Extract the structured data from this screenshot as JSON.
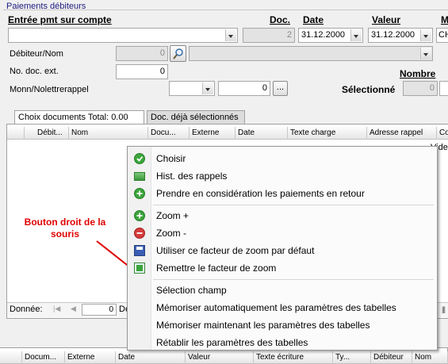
{
  "group": {
    "title": "Paiements débiteurs"
  },
  "header": {
    "entry_label": "Entrée pmt sur compte",
    "doc_label": "Doc.",
    "date_label": "Date",
    "valeur_label": "Valeur",
    "m_label": "M",
    "doc_value": "2",
    "date_value": "31.12.2000",
    "valeur_value": "31.12.2000",
    "m_value": "CH"
  },
  "form": {
    "debiteur_label": "Débiteur/Nom",
    "debiteur_value": "0",
    "nodoc_label": "No. doc. ext.",
    "nodoc_value": "0",
    "monn_label": "Monn/Nolettrerappel",
    "monn_value": "0",
    "ellipsis": "...",
    "nombre_label": "Nombre",
    "selectionne_label": "Sélectionné",
    "selectionne_value": "0"
  },
  "tabs": [
    {
      "label": "Choix documents Total:  0.00"
    },
    {
      "label": "Doc. déjà sélectionnés"
    }
  ],
  "grid": {
    "columns": [
      "Débit...",
      "Nom",
      "Docu...",
      "Externe",
      "Date",
      "Texte charge",
      "Adresse rappel",
      "Co"
    ],
    "vide": "Vide",
    "status_label": "Donnée:",
    "status_value": "0",
    "status_trail": "De"
  },
  "bottom_grid": {
    "columns": [
      "Docum...",
      "Externe",
      "Date",
      "Valeur",
      "Texte écriture",
      "Ty...",
      "Débiteur",
      "Nom"
    ]
  },
  "annotation": "Bouton droit de la souris",
  "context_menu": [
    {
      "label": "Choisir",
      "icon": "check-circle-icon"
    },
    {
      "label": "Hist. des rappels",
      "icon": "table-grid-icon"
    },
    {
      "label": "Prendre en considération les paiements en retour",
      "icon": "plus-circle-icon"
    },
    {
      "label": "Zoom +",
      "icon": "zoom-plus-icon"
    },
    {
      "label": "Zoom -",
      "icon": "zoom-minus-icon"
    },
    {
      "label": "Utiliser ce facteur de zoom par défaut",
      "icon": "save-disk-icon"
    },
    {
      "label": "Remettre le facteur de zoom",
      "icon": "reset-zoom-icon"
    },
    {
      "label": "Sélection champ",
      "icon": ""
    },
    {
      "label": "Mémoriser automatiquement les paramètres des tabelles",
      "icon": ""
    },
    {
      "label": "Mémoriser maintenant les paramètres des tabelles",
      "icon": ""
    },
    {
      "label": "Rétablir les paramètres des tabelles",
      "icon": ""
    }
  ],
  "colors": {
    "green": "#3aa53a",
    "red": "#d63b3b",
    "annotation": "#e00000",
    "title_blue": "#1c1c80"
  }
}
